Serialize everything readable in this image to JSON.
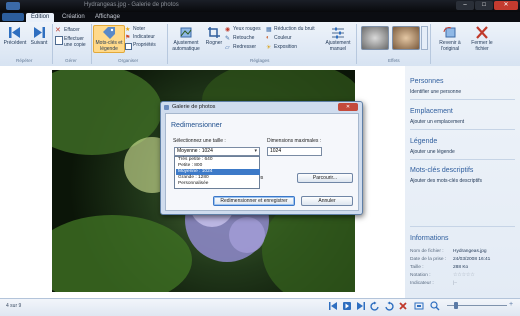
{
  "window": {
    "title": "Hydrangeas.jpg - Galerie de photos",
    "min": "–",
    "max": "□",
    "close": "✕"
  },
  "tabs": [
    {
      "label": "Édition"
    },
    {
      "label": "Création"
    },
    {
      "label": "Affichage"
    }
  ],
  "ribbon": {
    "repeter": {
      "prev": "Précédent",
      "next": "Suivant",
      "group": "Répéter"
    },
    "gerer": {
      "delete": "Effacer",
      "copy": "Effectuer une copie",
      "group": "Gérer"
    },
    "organiser": {
      "keywords": "Mots-clés et légende",
      "rate": "Noter",
      "flag": "Indicateur",
      "props": "Propriétés",
      "group": "Organiser"
    },
    "reglages": {
      "auto": "Ajustement automatique",
      "crop": "Rogner",
      "redeye": "Yeux rouges",
      "retouch": "Retouche",
      "straighten": "Redresser",
      "noise": "Réduction du bruit",
      "color": "Couleur",
      "exposure": "Exposition",
      "manual": "Ajustement manuel",
      "group": "Réglages"
    },
    "effets": {
      "group": "Effets"
    },
    "original": {
      "revert": "Revenir à l'original",
      "close": "Fermer le fichier"
    }
  },
  "pane": {
    "persons": {
      "title": "Personnes",
      "link": "Identifier une personne"
    },
    "location": {
      "title": "Emplacement",
      "link": "Ajouter un emplacement"
    },
    "caption": {
      "title": "Légende",
      "link": "Ajouter une légende"
    },
    "keywords": {
      "title": "Mots-clés descriptifs",
      "link": "Ajouter des mots-clés descriptifs"
    },
    "info": {
      "title": "Informations",
      "rows": [
        {
          "label": "Nom de fichier :",
          "value": "Hydrangeas.jpg"
        },
        {
          "label": "Date de la prise :",
          "value": "24/03/2008  16:41"
        },
        {
          "label": "Taille :",
          "value": "288 Ko"
        },
        {
          "label": "Notation :",
          "value": "☆☆☆☆☆"
        },
        {
          "label": "Indicateur :",
          "value": "|–"
        }
      ]
    }
  },
  "status": {
    "position": "4 sur 9"
  },
  "dialog": {
    "title": "Galerie de photos",
    "heading": "Redimensionner",
    "size_label": "Sélectionnez une taille :",
    "selected_size": "Moyenne : 1024",
    "max_label": "Dimensions maximales :",
    "max_value": "1024",
    "options": [
      "Très petite : 640",
      "Petite : 800",
      "Moyenne : 1024",
      "Grande : 1280",
      "Personnalisée"
    ],
    "selected_index": 2,
    "partial_text": "es",
    "browse": "Parcourir...",
    "resize_save": "Redimensionner et enregistrer",
    "cancel": "Annuler"
  },
  "colors": {
    "accent": "#2f5e9e",
    "selection": "#3d7ac8",
    "titlebar": "#0b0d12"
  }
}
